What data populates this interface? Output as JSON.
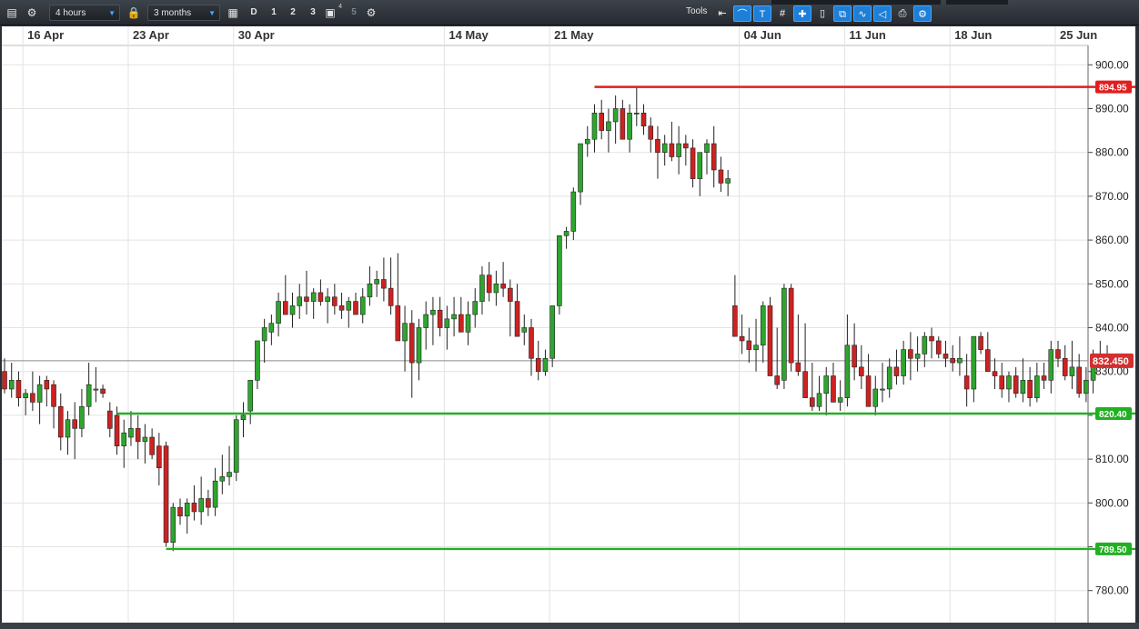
{
  "toolbar": {
    "timeframe": "4 hours",
    "range": "3 months",
    "periods": [
      "D",
      "1",
      "2",
      "3",
      "4",
      "5"
    ],
    "tools_label": "Tools",
    "icons": [
      "list-icon",
      "gear-icon",
      "lock-icon",
      "calendar-icon",
      "layers-icon",
      "settings-gear-icon"
    ],
    "accent": "#1e7fd6"
  },
  "chart_data": {
    "type": "candlestick",
    "x_tick_labels": [
      {
        "label": "16 Apr",
        "idx": 3
      },
      {
        "label": "23 Apr",
        "idx": 18
      },
      {
        "label": "30 Apr",
        "idx": 33
      },
      {
        "label": "14 May",
        "idx": 63
      },
      {
        "label": "21 May",
        "idx": 78
      },
      {
        "label": "04 Jun",
        "idx": 105
      },
      {
        "label": "11 Jun",
        "idx": 120
      },
      {
        "label": "18 Jun",
        "idx": 135
      },
      {
        "label": "25 Jun",
        "idx": 150
      }
    ],
    "y_axis": {
      "min": 776,
      "max": 904,
      "ticks": [
        780,
        790,
        800,
        810,
        820,
        830,
        840,
        850,
        860,
        870,
        880,
        890,
        900
      ],
      "tick_labels": [
        "780.00",
        "",
        "800.00",
        "810.00",
        "820.00",
        "830.00",
        "840.00",
        "850.00",
        "860.00",
        "870.00",
        "880.00",
        "890.00",
        "900.00"
      ]
    },
    "current_price": {
      "value": 832.45,
      "label": "832.450",
      "color": "#d32f2f"
    },
    "levels": [
      {
        "value": 894.95,
        "label": "894.95",
        "color": "#e31e1e",
        "start_idx": 84
      },
      {
        "value": 820.4,
        "label": "820.40",
        "color": "#22b022",
        "start_idx": 16
      },
      {
        "value": 789.5,
        "label": "789.50",
        "color": "#22b022",
        "start_idx": 23
      }
    ],
    "colors": {
      "up": "#2ea52e",
      "down": "#cc2222"
    },
    "candles": [
      [
        830,
        833,
        825,
        826
      ],
      [
        826,
        832,
        824,
        828
      ],
      [
        828,
        830,
        822,
        824
      ],
      [
        824,
        826,
        820,
        825
      ],
      [
        825,
        830,
        821,
        823
      ],
      [
        823,
        829,
        818,
        827
      ],
      [
        828,
        829,
        822,
        826
      ],
      [
        827,
        828,
        817,
        822
      ],
      [
        822,
        825,
        812,
        815
      ],
      [
        815,
        821,
        811,
        819
      ],
      [
        819,
        823,
        810,
        817
      ],
      [
        817,
        826,
        815,
        822
      ],
      [
        822,
        832,
        820,
        827
      ],
      [
        826,
        831,
        823,
        826
      ],
      [
        826,
        827,
        824,
        825
      ],
      [
        821,
        823,
        815,
        817
      ],
      [
        820,
        822,
        811,
        813
      ],
      [
        813,
        819,
        808,
        816
      ],
      [
        815,
        821,
        813,
        817
      ],
      [
        817,
        820,
        810,
        814
      ],
      [
        814,
        818,
        809,
        815
      ],
      [
        815,
        817,
        810,
        811
      ],
      [
        813,
        816,
        804,
        808
      ],
      [
        813,
        814,
        790,
        791
      ],
      [
        791,
        800,
        789,
        799
      ],
      [
        799,
        801,
        795,
        797
      ],
      [
        797,
        801,
        793,
        800
      ],
      [
        800,
        804,
        796,
        798
      ],
      [
        798,
        806,
        795,
        801
      ],
      [
        801,
        803,
        797,
        799
      ],
      [
        799,
        808,
        797,
        805
      ],
      [
        805,
        811,
        802,
        806
      ],
      [
        806,
        813,
        804,
        807
      ],
      [
        807,
        820,
        805,
        819
      ],
      [
        819,
        823,
        815,
        820
      ],
      [
        821,
        826,
        818,
        828
      ],
      [
        828,
        834,
        826,
        837
      ],
      [
        837,
        842,
        832,
        840
      ],
      [
        839,
        843,
        836,
        841
      ],
      [
        841,
        848,
        838,
        846
      ],
      [
        846,
        852,
        843,
        843
      ],
      [
        843,
        848,
        840,
        845
      ],
      [
        845,
        850,
        842,
        847
      ],
      [
        847,
        853,
        843,
        846
      ],
      [
        846,
        849,
        842,
        848
      ],
      [
        848,
        851,
        845,
        846
      ],
      [
        846,
        849,
        841,
        847
      ],
      [
        847,
        850,
        843,
        845
      ],
      [
        845,
        848,
        842,
        844
      ],
      [
        844,
        847,
        840,
        846
      ],
      [
        846,
        848,
        843,
        843
      ],
      [
        843,
        849,
        841,
        847
      ],
      [
        847,
        854,
        845,
        850
      ],
      [
        850,
        853,
        847,
        851
      ],
      [
        851,
        856,
        846,
        849
      ],
      [
        849,
        856,
        843,
        845
      ],
      [
        845,
        857,
        840,
        837
      ],
      [
        837,
        845,
        830,
        841
      ],
      [
        841,
        844,
        824,
        832
      ],
      [
        832,
        842,
        828,
        840
      ],
      [
        840,
        846,
        835,
        843
      ],
      [
        843,
        847,
        836,
        844
      ],
      [
        844,
        847,
        838,
        840
      ],
      [
        840,
        845,
        835,
        842
      ],
      [
        842,
        847,
        838,
        843
      ],
      [
        843,
        847,
        840,
        839
      ],
      [
        839,
        846,
        836,
        843
      ],
      [
        843,
        849,
        840,
        846
      ],
      [
        846,
        854,
        843,
        852
      ],
      [
        852,
        855,
        846,
        848
      ],
      [
        848,
        853,
        845,
        850
      ],
      [
        850,
        855,
        847,
        849
      ],
      [
        849,
        851,
        838,
        846
      ],
      [
        846,
        850,
        838,
        838
      ],
      [
        839,
        843,
        836,
        840
      ],
      [
        840,
        842,
        829,
        833
      ],
      [
        833,
        837,
        828,
        830
      ],
      [
        830,
        835,
        829,
        833
      ],
      [
        833,
        843,
        831,
        845
      ],
      [
        845,
        861,
        843,
        861
      ],
      [
        861,
        863,
        858,
        862
      ],
      [
        862,
        872,
        860,
        871
      ],
      [
        871,
        882,
        868,
        882
      ],
      [
        882,
        886,
        879,
        883
      ],
      [
        883,
        891,
        880,
        889
      ],
      [
        889,
        892,
        883,
        885
      ],
      [
        885,
        890,
        880,
        887
      ],
      [
        887,
        893,
        882,
        890
      ],
      [
        890,
        892,
        885,
        883
      ],
      [
        883,
        891,
        880,
        889
      ],
      [
        889,
        895,
        886,
        889
      ],
      [
        889,
        891,
        884,
        886
      ],
      [
        886,
        888,
        880,
        883
      ],
      [
        883,
        886,
        874,
        880
      ],
      [
        880,
        884,
        877,
        882
      ],
      [
        882,
        887,
        878,
        879
      ],
      [
        879,
        886,
        875,
        882
      ],
      [
        882,
        884,
        877,
        881
      ],
      [
        881,
        883,
        872,
        874
      ],
      [
        874,
        878,
        870,
        880
      ],
      [
        880,
        883,
        875,
        882
      ],
      [
        882,
        886,
        872,
        876
      ],
      [
        876,
        879,
        871,
        873
      ],
      [
        873,
        876,
        870,
        874
      ],
      [
        845,
        852,
        843,
        838
      ],
      [
        838,
        843,
        834,
        837
      ],
      [
        837,
        840,
        832,
        835
      ],
      [
        835,
        842,
        830,
        836
      ],
      [
        836,
        846,
        832,
        845
      ],
      [
        845,
        847,
        830,
        829
      ],
      [
        829,
        840,
        826,
        827
      ],
      [
        828,
        850,
        826,
        849
      ],
      [
        849,
        850,
        830,
        832
      ],
      [
        832,
        843,
        829,
        830
      ],
      [
        830,
        841,
        825,
        824
      ],
      [
        824,
        832,
        821,
        822
      ],
      [
        822,
        829,
        821,
        825
      ],
      [
        825,
        831,
        820,
        829
      ],
      [
        829,
        832,
        823,
        823
      ],
      [
        823,
        828,
        821,
        824
      ],
      [
        824,
        843,
        822,
        836
      ],
      [
        836,
        841,
        828,
        831
      ],
      [
        831,
        836,
        826,
        829
      ],
      [
        829,
        834,
        823,
        822
      ],
      [
        822,
        829,
        820,
        826
      ],
      [
        826,
        832,
        823,
        826
      ],
      [
        826,
        833,
        824,
        831
      ],
      [
        831,
        835,
        827,
        829
      ],
      [
        829,
        837,
        827,
        835
      ],
      [
        835,
        839,
        828,
        833
      ],
      [
        833,
        838,
        830,
        834
      ],
      [
        834,
        839,
        831,
        838
      ],
      [
        838,
        840,
        833,
        837
      ],
      [
        837,
        838,
        833,
        834
      ],
      [
        834,
        837,
        831,
        833
      ],
      [
        833,
        836,
        830,
        832
      ],
      [
        832,
        838,
        829,
        833
      ],
      [
        829,
        834,
        822,
        826
      ],
      [
        826,
        837,
        823,
        838
      ],
      [
        838,
        839,
        834,
        835
      ],
      [
        835,
        839,
        830,
        830
      ],
      [
        830,
        833,
        826,
        829
      ],
      [
        829,
        832,
        824,
        826
      ],
      [
        826,
        830,
        823,
        829
      ],
      [
        829,
        831,
        824,
        825
      ],
      [
        825,
        833,
        823,
        828
      ],
      [
        828,
        831,
        822,
        824
      ],
      [
        824,
        832,
        823,
        829
      ],
      [
        829,
        832,
        826,
        828
      ],
      [
        828,
        837,
        825,
        835
      ],
      [
        835,
        837,
        831,
        833
      ],
      [
        833,
        836,
        828,
        829
      ],
      [
        829,
        837,
        826,
        831
      ],
      [
        831,
        834,
        824,
        825
      ],
      [
        825,
        831,
        823,
        828
      ],
      [
        828,
        835,
        825,
        833
      ],
      [
        833,
        837,
        831,
        834
      ],
      [
        834,
        836,
        832,
        833
      ]
    ]
  }
}
